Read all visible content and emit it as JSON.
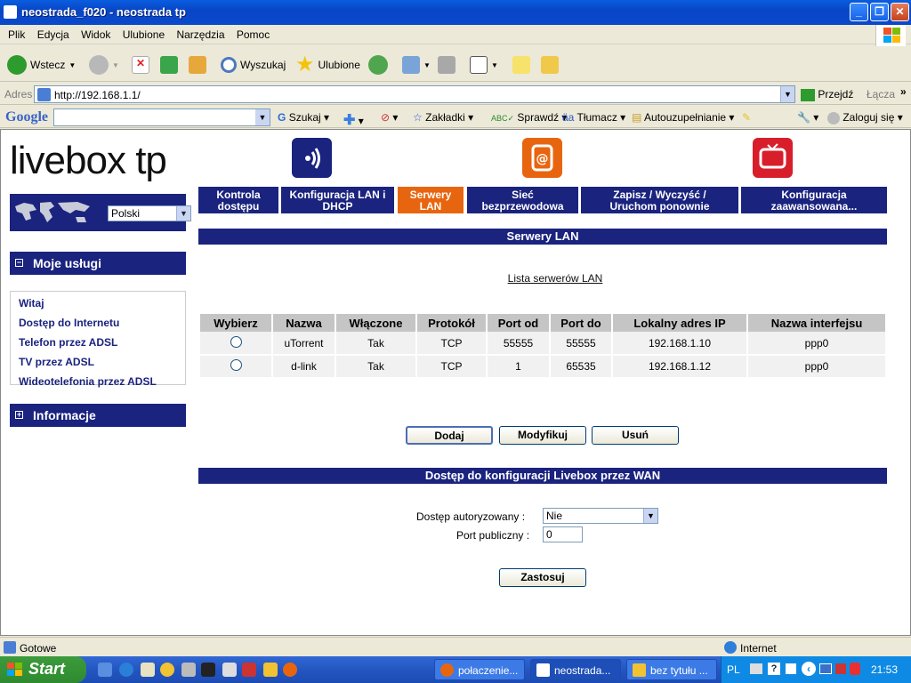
{
  "window": {
    "title": "neostrada_f020 - neostrada tp"
  },
  "menu": [
    "Plik",
    "Edycja",
    "Widok",
    "Ulubione",
    "Narzędzia",
    "Pomoc"
  ],
  "toolbar": {
    "back": "Wstecz",
    "search": "Wyszukaj",
    "favorites": "Ulubione"
  },
  "address": {
    "label": "Adres",
    "url": "http://192.168.1.1/",
    "go": "Przejdź",
    "links": "Łącza"
  },
  "google": {
    "logo": "Google",
    "search": "Szukaj",
    "bookmarks": "Zakładki",
    "check": "Sprawdź",
    "translate": "Tłumacz",
    "autofill": "Autouzupełnianie",
    "signin": "Zaloguj się"
  },
  "brand": {
    "logo": "livebox tp",
    "language": "Polski"
  },
  "nav": {
    "services_title": "Moje usługi",
    "services": [
      "Witaj",
      "Dostęp do Internetu",
      "Telefon przez ADSL",
      "TV przez ADSL",
      "Wideotelefonia przez ADSL"
    ],
    "info_title": "Informacje"
  },
  "tabs": [
    {
      "line1": "Kontrola",
      "line2": "dostępu"
    },
    {
      "line1": "Konfiguracja LAN i",
      "line2": "DHCP"
    },
    {
      "line1": "Serwery",
      "line2": "LAN"
    },
    {
      "line1": "Sieć",
      "line2": "bezprzewodowa"
    },
    {
      "line1": "Zapisz / Wyczyść /",
      "line2": "Uruchom ponownie"
    },
    {
      "line1": "Konfiguracja",
      "line2": "zaawansowana..."
    }
  ],
  "section1": {
    "title": "Serwery LAN",
    "list_link": "Lista serwerów LAN"
  },
  "table": {
    "headers": [
      "Wybierz",
      "Nazwa",
      "Włączone",
      "Protokół",
      "Port od",
      "Port do",
      "Lokalny adres IP",
      "Nazwa interfejsu"
    ],
    "rows": [
      [
        "uTorrent",
        "Tak",
        "TCP",
        "55555",
        "55555",
        "192.168.1.10",
        "ppp0"
      ],
      [
        "d-link",
        "Tak",
        "TCP",
        "1",
        "65535",
        "192.168.1.12",
        "ppp0"
      ]
    ]
  },
  "buttons": {
    "add": "Dodaj",
    "modify": "Modyfikuj",
    "delete": "Usuń",
    "apply": "Zastosuj"
  },
  "section2": {
    "title": "Dostęp do konfiguracji Livebox przez WAN",
    "auth_label": "Dostęp autoryzowany :",
    "auth_value": "Nie",
    "port_label": "Port publiczny :",
    "port_value": "0"
  },
  "status": {
    "left": "Gotowe",
    "zone": "Internet"
  },
  "taskbar": {
    "start": "Start",
    "tasks": [
      "połaczenie...",
      "neostrada...",
      "bez tytułu ..."
    ],
    "lang": "PL",
    "clock": "21:53"
  },
  "colors": {
    "nav_blue": "#1a237e",
    "active_tab": "#e8650f"
  }
}
